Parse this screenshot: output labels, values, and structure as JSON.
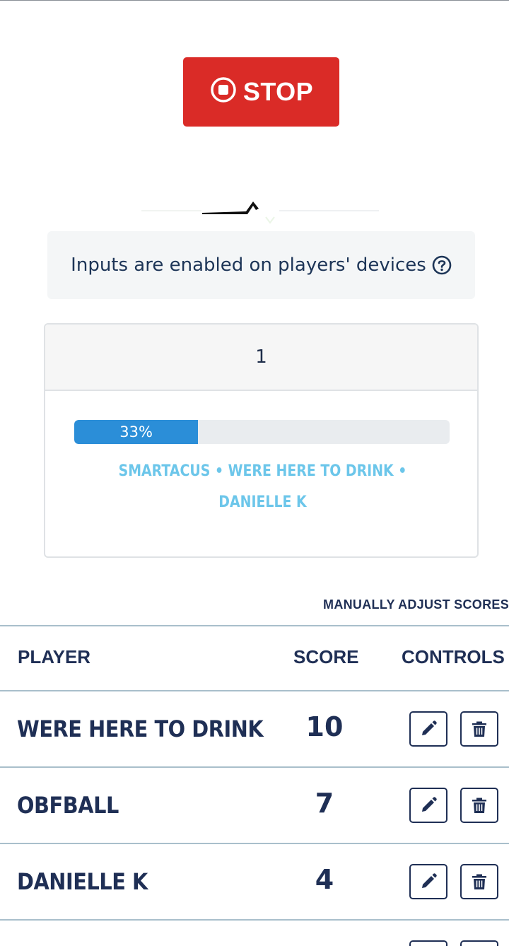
{
  "toolbar": {
    "stop_label": "STOP",
    "stop_icon": "stop-circle-icon",
    "stop_color": "#da2b27"
  },
  "banner": {
    "text": "Inputs are enabled on players' devices",
    "icon": "question-circle-icon"
  },
  "question_card": {
    "header": "1",
    "progress_percent": 33,
    "progress_label": "33%",
    "answered_players": "SMARTACUS • WERE HERE TO DRINK • DANIELLE K",
    "accent_color": "#2b8ed8",
    "names_color": "#6cc6ea"
  },
  "scores": {
    "manual_adjust_label": "MANUALLY ADJUST SCORES",
    "columns": {
      "player": "PLAYER",
      "score": "SCORE",
      "controls": "CONTROLS"
    },
    "rows": [
      {
        "player": "WERE HERE TO DRINK",
        "score": "10"
      },
      {
        "player": "OBFBALL",
        "score": "7"
      },
      {
        "player": "DANIELLE K",
        "score": "4"
      }
    ],
    "edit_icon": "pencil-icon",
    "delete_icon": "trash-icon"
  }
}
